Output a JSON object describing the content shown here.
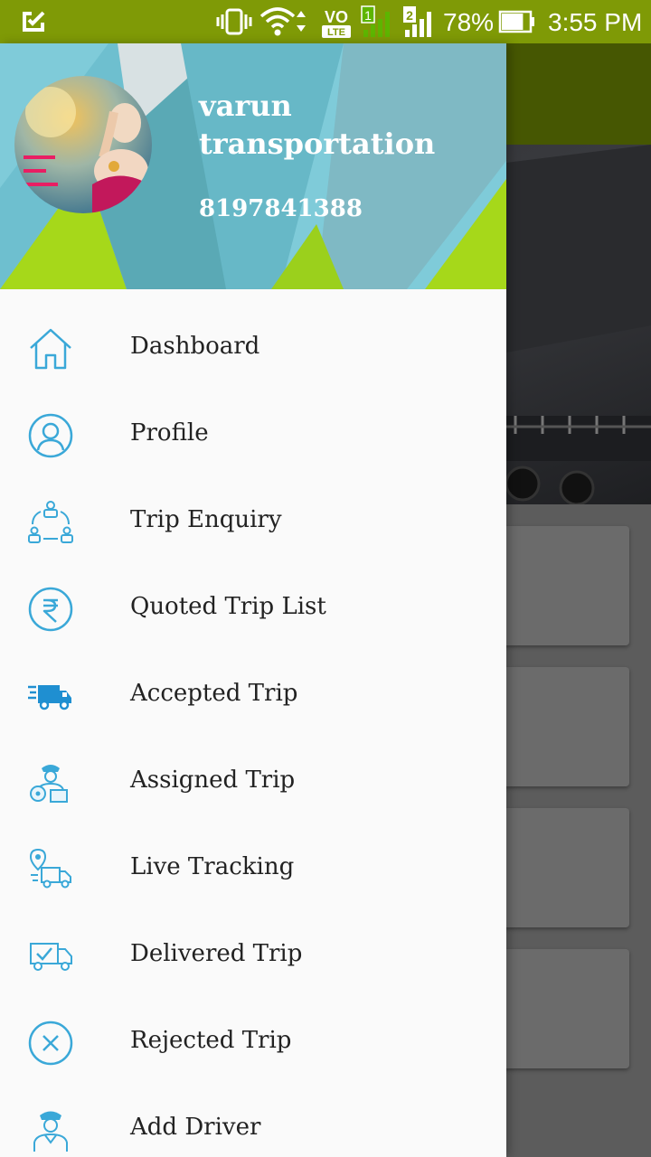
{
  "status_bar": {
    "battery_percent": "78%",
    "battery_level": 0.78,
    "time": "3:55 PM",
    "network_tag": "VO\nLTE",
    "sim1": "1",
    "sim2": "2"
  },
  "drawer": {
    "header": {
      "user_name": "varun transportation",
      "phone": "8197841388"
    },
    "items": [
      {
        "label": "Dashboard",
        "icon": "home-icon"
      },
      {
        "label": "Profile",
        "icon": "user-icon"
      },
      {
        "label": "Trip Enquiry",
        "icon": "trip-enquiry-icon"
      },
      {
        "label": "Quoted Trip List",
        "icon": "rupee-icon"
      },
      {
        "label": "Accepted Trip",
        "icon": "fast-truck-icon"
      },
      {
        "label": "Assigned Trip",
        "icon": "driver-icon"
      },
      {
        "label": "Live Tracking",
        "icon": "location-truck-icon"
      },
      {
        "label": "Delivered Trip",
        "icon": "delivered-truck-icon"
      },
      {
        "label": "Rejected Trip",
        "icon": "close-circle-icon"
      },
      {
        "label": "Add Driver",
        "icon": "add-driver-icon"
      }
    ]
  },
  "colors": {
    "status_bar": "#7f9a06",
    "toolbar_dimmed": "#465702",
    "icon_blue": "#3aa8d8",
    "header_cyan": "#7fcbd9",
    "header_lime": "#a6d81a",
    "header_teal": "#52a6b4"
  }
}
